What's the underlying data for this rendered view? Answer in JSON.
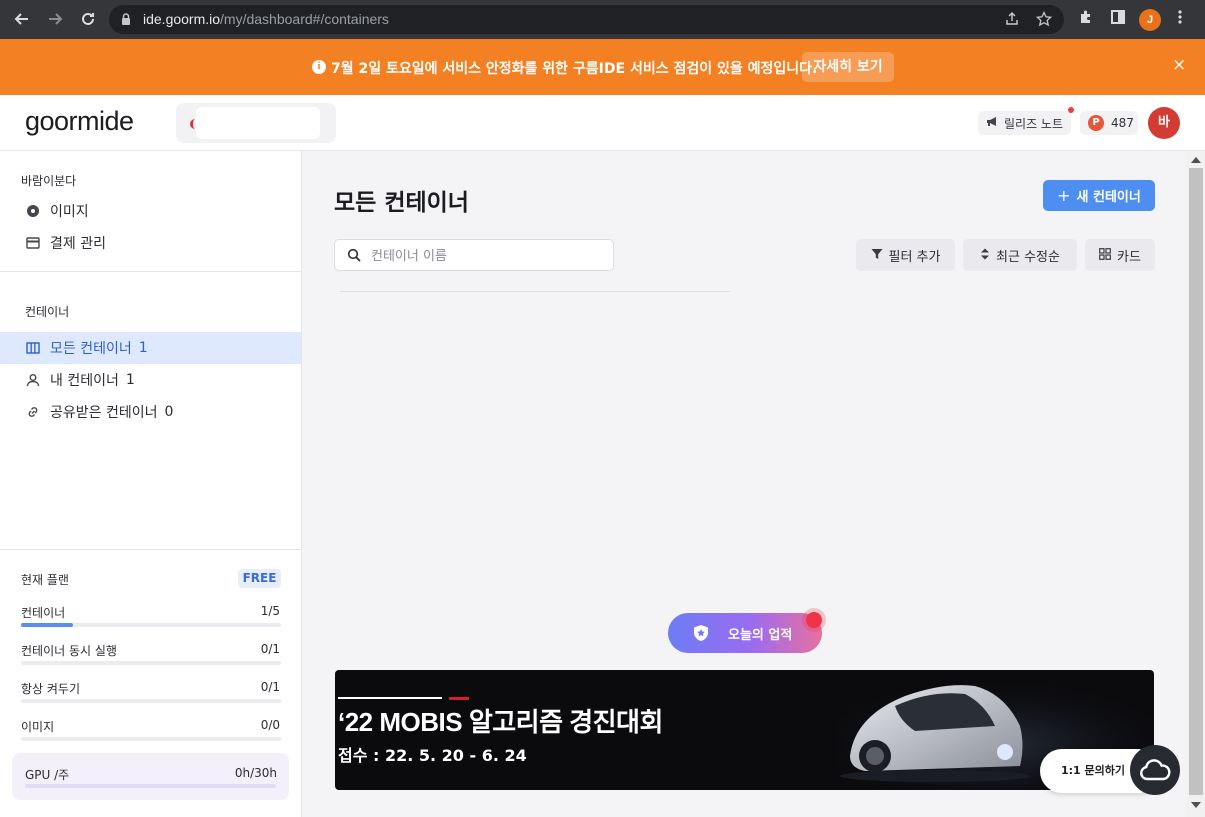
{
  "browser": {
    "url_host": "ide.goorm.io",
    "url_path": "/my/dashboard#/containers",
    "profile_initial": "J"
  },
  "banner": {
    "info_glyph": "i",
    "text": "7월 2일 토요일에 서비스 안정화를 위한 구름IDE 서비스 점검이 있을 예정입니다.",
    "button": "자세히 보기",
    "close": "×",
    "color": "#f48024"
  },
  "header": {
    "logo": "goormide",
    "release_notes": "릴리즈 노트",
    "point_badge": "P",
    "points": "487",
    "avatar": "바"
  },
  "sidebar": {
    "account_label": "바람이분다",
    "account_items": [
      {
        "label": "이미지",
        "icon": "disc-icon"
      },
      {
        "label": "결제 관리",
        "icon": "card-icon"
      }
    ],
    "container_label": "컨테이너",
    "container_items": [
      {
        "label": "모든 컨테이너",
        "count": "1",
        "icon": "columns-icon",
        "active": true
      },
      {
        "label": "내 컨테이너",
        "count": "1",
        "icon": "user-icon",
        "active": false
      },
      {
        "label": "공유받은 컨테이너",
        "count": "0",
        "icon": "link-icon",
        "active": false
      }
    ],
    "plan": {
      "title": "현재 플랜",
      "badge": "FREE",
      "quotas": [
        {
          "label": "컨테이너",
          "value": "1/5",
          "fraction": 0.2
        },
        {
          "label": "컨테이너 동시 실행",
          "value": "0/1",
          "fraction": 0
        },
        {
          "label": "항상 켜두기",
          "value": "0/1",
          "fraction": 0
        },
        {
          "label": "이미지",
          "value": "0/0",
          "fraction": 0
        }
      ],
      "gpu": {
        "label": "GPU /주",
        "value": "0h/30h",
        "fraction": 0
      }
    }
  },
  "main": {
    "title": "모든 컨테이너",
    "new_button": "새 컨테이너",
    "search_placeholder": "컨테이너 이름",
    "toolbar": {
      "filter": "필터 추가",
      "sort": "최근 수정순",
      "view": "카드"
    },
    "achievement": "오늘의 업적",
    "ad": {
      "title": "‘22 MOBIS 알고리즘 경진대회",
      "date": "접수 : 22. 5. 20 - 6. 24"
    },
    "help": "1:1 문의하기"
  },
  "colors": {
    "primary": "#4d8ef0",
    "active_bg": "#dfe9fd",
    "active_text": "#2c5fd1",
    "avatar": "#d33c35"
  }
}
